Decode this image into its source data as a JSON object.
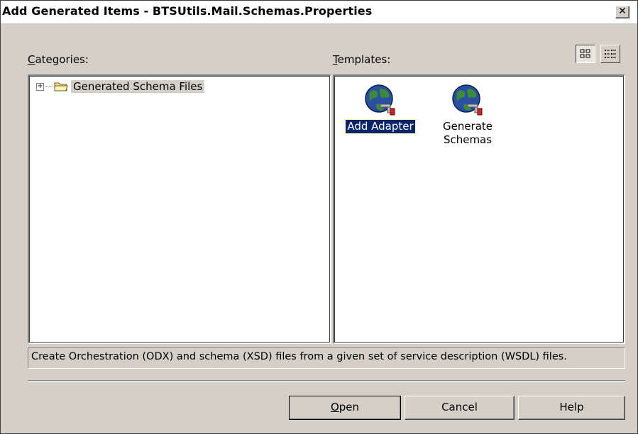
{
  "window": {
    "title": "Add Generated Items - BTSUtils.Mail.Schemas.Properties",
    "close_label": "✕"
  },
  "categories": {
    "label_first": "C",
    "label_rest": "ategories:",
    "items": [
      {
        "label": "Generated Schema Files",
        "expander": "+"
      }
    ]
  },
  "templates": {
    "label_first": "T",
    "label_rest": "emplates:",
    "view_large_icon": "large-icons-view-icon",
    "view_list_icon": "list-view-icon",
    "items": [
      {
        "label_line1": "Add Adapter",
        "label_line2": "",
        "selected": true,
        "icon": "globe-adapter-icon"
      },
      {
        "label_line1": "Generate",
        "label_line2": "Schemas",
        "selected": false,
        "icon": "globe-adapter-icon"
      }
    ]
  },
  "description": "Create Orchestration (ODX) and schema (XSD) files from a given set of service description (WSDL) files.",
  "buttons": {
    "open_first": "O",
    "open_rest": "pen",
    "cancel": "Cancel",
    "help": "Help"
  },
  "colors": {
    "dialog_bg": "#d4d0c8",
    "selection_bg": "#0a246a",
    "selection_fg": "#ffffff"
  }
}
